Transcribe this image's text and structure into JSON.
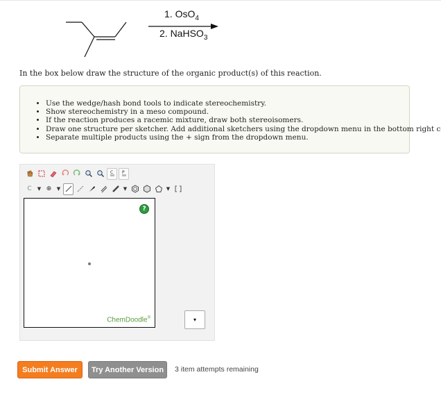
{
  "reaction": {
    "reagent_1": "1. OsO",
    "reagent_1_sub": "4",
    "reagent_2": "2. NaHSO",
    "reagent_2_sub": "3"
  },
  "instruction": "In the box below draw the structure of the organic product(s) of this reaction.",
  "hints": [
    "Use the wedge/hash bond tools to indicate stereochemistry.",
    "Show stereochemistry in a meso compound.",
    "If the reaction produces a racemic mixture, draw both stereoisomers.",
    "Draw one structure per sketcher. Add additional sketchers using the dropdown menu in the bottom right corner.",
    "Separate multiple products using the + sign from the dropdown menu."
  ],
  "sketcher": {
    "toolbar_row1": [
      "hand-icon",
      "lasso-icon",
      "eraser-icon",
      "undo-icon",
      "redo-icon",
      "zoom-in-icon",
      "zoom-out-icon",
      "copy-icon",
      "paste-icon"
    ],
    "element_label": "C",
    "charge_label": "⊕",
    "help_label": "?",
    "brand": "ChemDoodle",
    "brand_mark": "®",
    "add_dropdown_label": "▾"
  },
  "buttons": {
    "submit": "Submit Answer",
    "try_another": "Try Another Version"
  },
  "attempts": "3 item attempts remaining",
  "colors": {
    "submit_bg": "#f47d1f",
    "try_another_bg": "#8f8f8f",
    "help_icon": "#2e9b3f",
    "brand_text": "#5a9a3a"
  }
}
